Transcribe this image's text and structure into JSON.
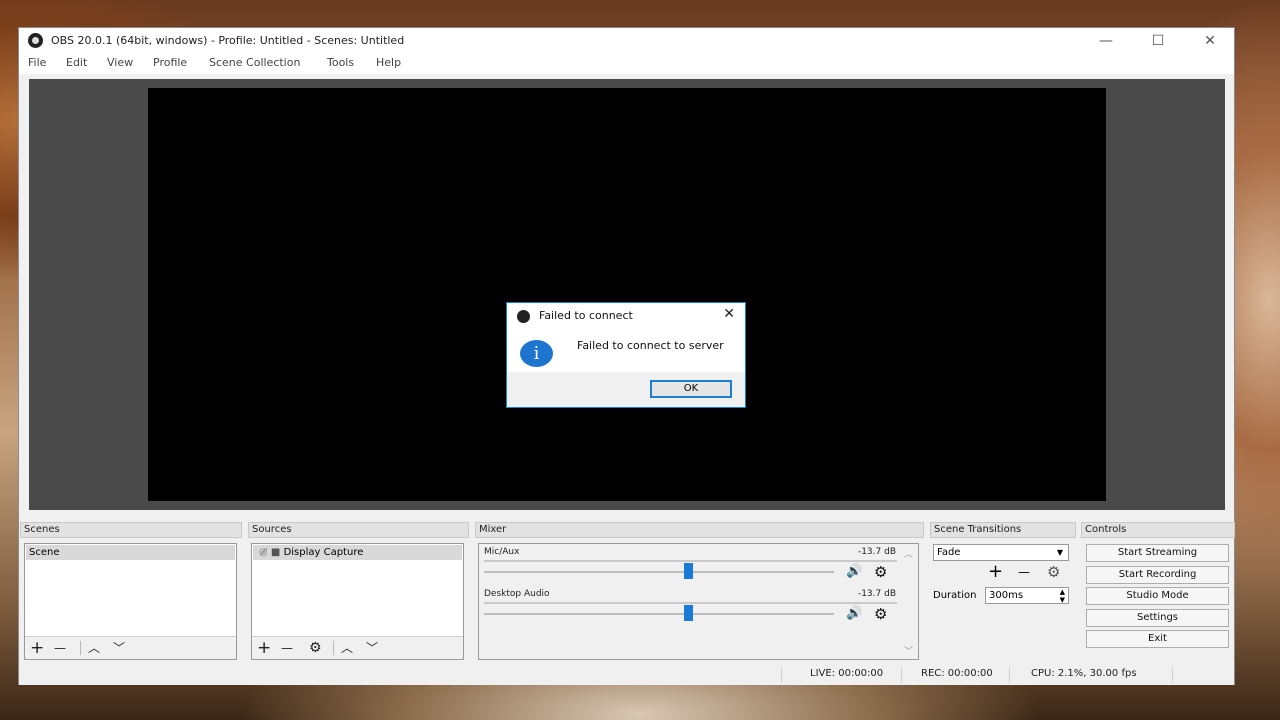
{
  "window": {
    "title": "OBS 20.0.1 (64bit, windows) - Profile: Untitled - Scenes: Untitled",
    "controls": {
      "minimize": "—",
      "maximize": "☐",
      "close": "✕"
    }
  },
  "menu": [
    "File",
    "Edit",
    "View",
    "Profile",
    "Scene Collection",
    "Tools",
    "Help"
  ],
  "docks": {
    "scenes": {
      "header": "Scenes",
      "items": [
        "Scene"
      ]
    },
    "sources": {
      "header": "Sources",
      "items": [
        "Display Capture"
      ]
    },
    "mixer": {
      "header": "Mixer",
      "channels": [
        {
          "name": "Mic/Aux",
          "level": "-13.7 dB"
        },
        {
          "name": "Desktop Audio",
          "level": "-13.7 dB"
        }
      ]
    },
    "transitions": {
      "header": "Scene Transitions",
      "selected": "Fade",
      "duration_label": "Duration",
      "duration_value": "300ms"
    },
    "controls": {
      "header": "Controls",
      "buttons": [
        "Start Streaming",
        "Start Recording",
        "Studio Mode",
        "Settings",
        "Exit"
      ]
    }
  },
  "toolbar_glyphs": {
    "add": "+",
    "remove": "—",
    "up": "︿",
    "down": "﹀",
    "gear": "⚙"
  },
  "status": {
    "live": "LIVE: 00:00:00",
    "rec": "REC: 00:00:00",
    "cpu": "CPU: 2.1%, 30.00 fps"
  },
  "dialog": {
    "title": "Failed to connect",
    "message": "Failed to connect to server",
    "ok": "OK",
    "icon": "i"
  },
  "colors": {
    "accent": "#1a7ad6",
    "preview_bg": "#000000",
    "canvas_bg": "#4a4a4a"
  }
}
